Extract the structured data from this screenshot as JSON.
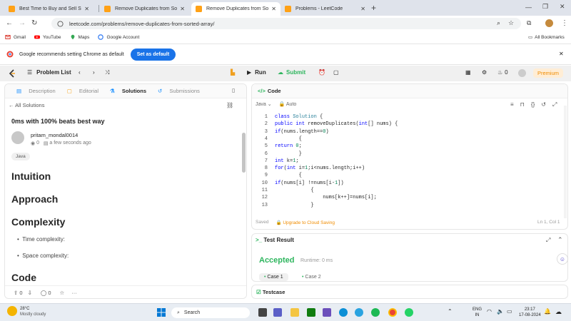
{
  "browser": {
    "tabs": [
      {
        "title": "Best Time to Buy and Sell Stock",
        "active": false
      },
      {
        "title": "Remove Duplicates from Sorted",
        "active": false
      },
      {
        "title": "Remove Duplicates from Sorted",
        "active": true
      },
      {
        "title": "Problems - LeetCode",
        "active": false
      }
    ],
    "url": "leetcode.com/problems/remove-duplicates-from-sorted-array/",
    "bookmarks": [
      "Gmail",
      "YouTube",
      "Maps",
      "Google Account"
    ],
    "all_bookmarks": "All Bookmarks",
    "notification": {
      "text": "Google recommends setting Chrome as default",
      "button": "Set as default"
    }
  },
  "lc_nav": {
    "problem_list": "Problem List",
    "run": "Run",
    "submit": "Submit",
    "streak": "0",
    "premium": "Premium"
  },
  "left_panel": {
    "tabs": [
      "Description",
      "Editorial",
      "Solutions",
      "Submissions"
    ],
    "back": "All Solutions",
    "title": "0ms with 100% beats best way",
    "author": "pritam_mondal0014",
    "views": "0",
    "time": "a few seconds ago",
    "tag": "Java",
    "h_intuition": "Intuition",
    "h_approach": "Approach",
    "h_complexity": "Complexity",
    "time_complexity": "Time complexity:",
    "space_complexity": "Space complexity:",
    "h_code": "Code",
    "votes": "0",
    "comments": "0"
  },
  "code_panel": {
    "title": "Code",
    "language": "Java",
    "auto": "Auto",
    "saved": "Saved",
    "upgrade": "Upgrade to Cloud Saving",
    "cursor": "Ln 1, Col 1",
    "lines": [
      "class Solution {",
      "    public int removeDuplicates(int[] nums) {",
      "        if(nums.length==0)",
      "        {",
      "            return 0;",
      "        }",
      "        int k=1;",
      "        for(int i=1;i<nums.length;i++)",
      "        {",
      "            if(nums[i] !=nums[i-1])",
      "            {",
      "                nums[k++]=nums[i];",
      "            }"
    ]
  },
  "test_panel": {
    "title": "Test Result",
    "status": "Accepted",
    "runtime": "Runtime: 0 ms",
    "cases": [
      "Case 1",
      "Case 2"
    ],
    "testcase": "Testcase"
  },
  "taskbar": {
    "temp": "28°C",
    "weather": "Mostly cloudy",
    "search": "Search",
    "lang1": "ENG",
    "lang2": "IN",
    "time": "23:17",
    "date": "17-08-2024"
  }
}
